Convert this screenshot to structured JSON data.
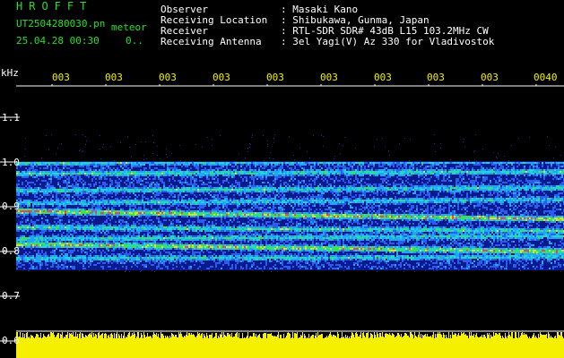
{
  "header": {
    "app_title": "HROFFT",
    "filename": "UT2504280030.pn",
    "mode": "meteor",
    "datetime": "25.04.28 00:30",
    "counter": "0..",
    "info": [
      {
        "label": "Observer",
        "value": ": Masaki Kano"
      },
      {
        "label": "Receiving Location",
        "value": ": Shibukawa, Gunma, Japan"
      },
      {
        "label": "Receiver",
        "value": ": RTL-SDR SDR# 43dB L15 103.2MHz CW"
      },
      {
        "label": "Receiving Antenna",
        "value": ": 3el Yagi(V) Az 330 for Vladivostok"
      }
    ]
  },
  "axis": {
    "unit": "kHz",
    "y_ticks": [
      "1.1",
      "1.0",
      "0.9",
      "0.8",
      "0.7",
      "0.6"
    ],
    "x_ticks": [
      "003",
      "003",
      "003",
      "003",
      "003",
      "003",
      "003",
      "003",
      "003",
      "0040"
    ]
  },
  "colors": {
    "background": "#000000",
    "label_green": "#27e027",
    "label_white": "#ffffff",
    "time_yellow": "#f5f000",
    "baseline_yellow": "#f5f000",
    "waterfall_base": "#0a1a8c"
  }
}
